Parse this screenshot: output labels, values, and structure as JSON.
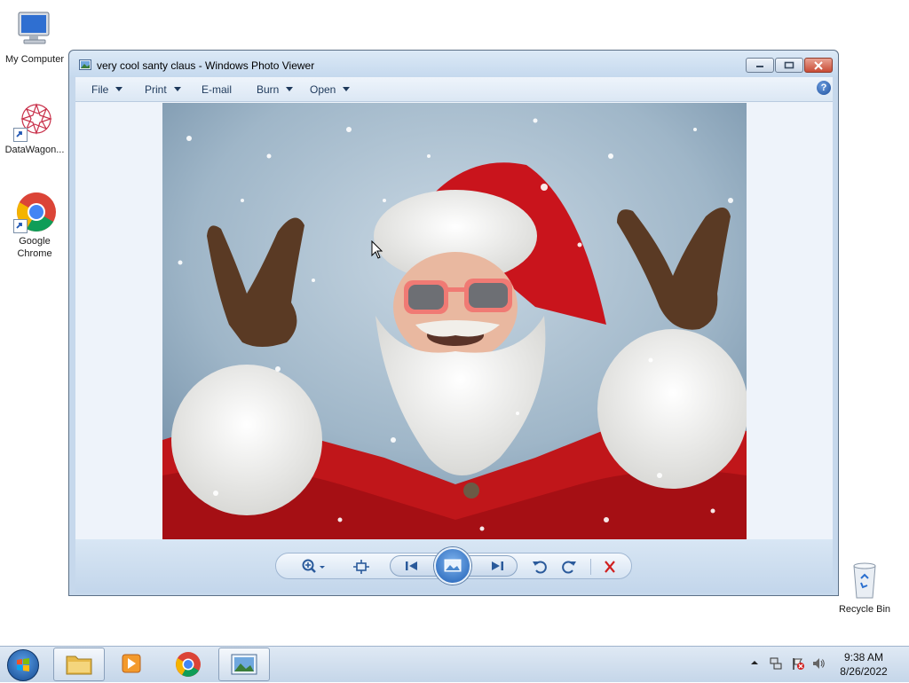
{
  "desktop": {
    "icons": [
      {
        "label": "My Computer"
      },
      {
        "label": "DataWagon..."
      },
      {
        "label": "Google Chrome"
      },
      {
        "label": "Recycle Bin"
      }
    ]
  },
  "window": {
    "title": "very cool santy claus - Windows Photo Viewer",
    "menu": {
      "file": "File",
      "print": "Print",
      "email": "E-mail",
      "burn": "Burn",
      "open": "Open"
    },
    "help_glyph": "?"
  },
  "photo": {
    "subject": "Santa Claus in sunglasses making rock-horn hand signs in the snow"
  },
  "toolbar": {
    "buttons": [
      "zoom-icon",
      "actual-size-icon",
      "previous-icon",
      "slideshow-icon",
      "next-icon",
      "rotate-counterclockwise-icon",
      "rotate-clockwise-icon",
      "delete-icon"
    ]
  },
  "taskbar": {
    "time": "9:38 AM",
    "date": "8/26/2022"
  },
  "colors": {
    "window_frame": "#c6d8ec",
    "accent_blue": "#1f5fb5",
    "delete_red": "#d02020",
    "santa_red": "#c0161a"
  }
}
